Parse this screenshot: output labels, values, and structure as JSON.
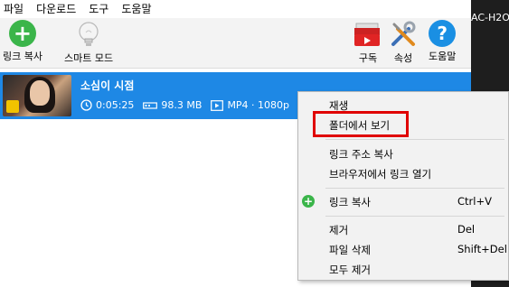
{
  "menu": {
    "items": [
      "파일",
      "다운로드",
      "도구",
      "도움말"
    ]
  },
  "toolbar": {
    "copy_link_label": "링크 복사",
    "smart_mode_label": "스마트 모드",
    "subscribe_label": "구독",
    "settings_label": "속성",
    "help_label": "도움말"
  },
  "download": {
    "title": "소심이 시점",
    "duration": "0:05:25",
    "size": "98.3 MB",
    "format": "MP4 · 1080p"
  },
  "side_window": {
    "text": "AC-H2O"
  },
  "context_menu": {
    "play": "재생",
    "show_in_folder": "폴더에서 보기",
    "copy_link_address": "링크 주소 복사",
    "open_link_in_browser": "브라우저에서 링크 열기",
    "copy_link": "링크 복사",
    "copy_link_shortcut": "Ctrl+V",
    "remove": "제거",
    "remove_shortcut": "Del",
    "delete_file": "파일 삭제",
    "delete_file_shortcut": "Shift+Del",
    "remove_all": "모두 제거"
  },
  "colors": {
    "selection": "#1e88e5",
    "highlight_box": "#e00000",
    "green_plus": "#3bb54a",
    "help_blue": "#1a8fe3"
  }
}
